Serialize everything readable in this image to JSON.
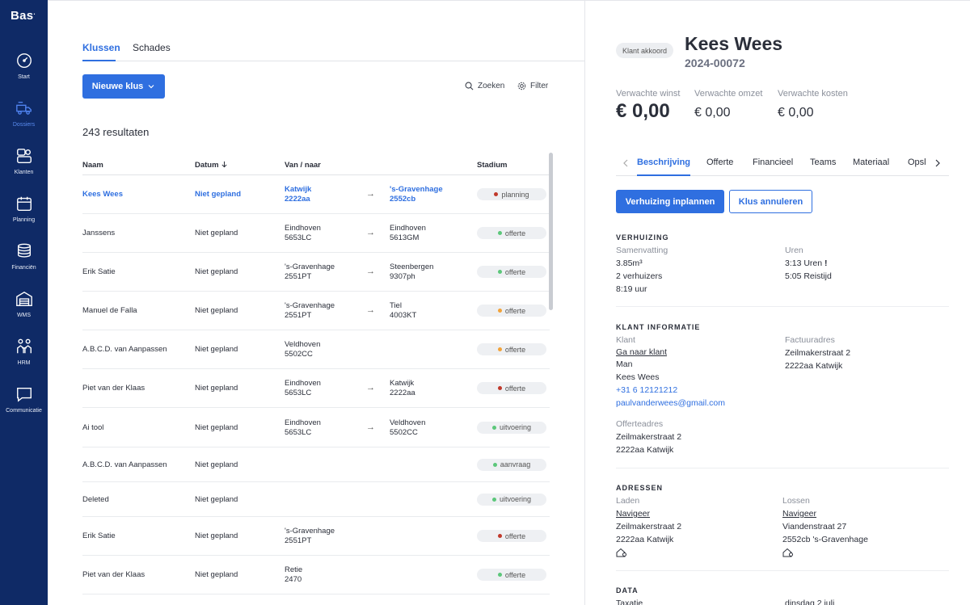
{
  "app": {
    "logo": "Bas",
    "logo_dot": "."
  },
  "sidebar": {
    "items": [
      {
        "label": "Start",
        "icon": "dashboard-icon"
      },
      {
        "label": "Dossiers",
        "icon": "truck-icon",
        "active": true
      },
      {
        "label": "Klanten",
        "icon": "users-icon"
      },
      {
        "label": "Planning",
        "icon": "calendar-icon"
      },
      {
        "label": "Financiën",
        "icon": "coins-icon"
      },
      {
        "label": "WMS",
        "icon": "warehouse-icon"
      },
      {
        "label": "HRM",
        "icon": "people-icon"
      },
      {
        "label": "Communicatie",
        "icon": "chat-icon"
      }
    ]
  },
  "list": {
    "tabs": [
      "Klussen",
      "Schades"
    ],
    "new_button": "Nieuwe klus",
    "search_label": "Zoeken",
    "filter_label": "Filter",
    "results": "243 resultaten",
    "columns": {
      "name": "Naam",
      "date": "Datum",
      "route": "Van / naar",
      "stage": "Stadium"
    },
    "rows": [
      {
        "name": "Kees Wees",
        "date": "Niet gepland",
        "from1": "Katwijk",
        "from2": "2222aa",
        "to1": "'s-Gravenhage",
        "to2": "2552cb",
        "stage": "planning",
        "color": "#c0392b",
        "highlight": true
      },
      {
        "name": "Janssens",
        "date": "Niet gepland",
        "from1": "Eindhoven",
        "from2": "5653LC",
        "to1": "Eindhoven",
        "to2": "5613GM",
        "stage": "offerte",
        "color": "#5cc77a"
      },
      {
        "name": "Erik Satie",
        "date": "Niet gepland",
        "from1": "'s-Gravenhage",
        "from2": "2551PT",
        "to1": "Steenbergen",
        "to2": "9307ph",
        "stage": "offerte",
        "color": "#5cc77a"
      },
      {
        "name": "Manuel de Falla",
        "date": "Niet gepland",
        "from1": "'s-Gravenhage",
        "from2": "2551PT",
        "to1": "Tiel",
        "to2": "4003KT",
        "stage": "offerte",
        "color": "#f2a33a"
      },
      {
        "name": "A.B.C.D. van Aanpassen",
        "date": "Niet gepland",
        "from1": "Veldhoven",
        "from2": "5502CC",
        "to1": "",
        "to2": "",
        "stage": "offerte",
        "color": "#f2a33a"
      },
      {
        "name": "Piet van der Klaas",
        "date": "Niet gepland",
        "from1": "Eindhoven",
        "from2": "5653LC",
        "to1": "Katwijk",
        "to2": "2222aa",
        "stage": "offerte",
        "color": "#c0392b"
      },
      {
        "name": "Ai tool",
        "date": "Niet gepland",
        "from1": "Eindhoven",
        "from2": "5653LC",
        "to1": "Veldhoven",
        "to2": "5502CC",
        "stage": "uitvoering",
        "color": "#5cc77a"
      },
      {
        "name": "A.B.C.D. van Aanpassen",
        "date": "Niet gepland",
        "from1": "",
        "from2": "",
        "to1": "",
        "to2": "",
        "stage": "aanvraag",
        "color": "#5cc77a"
      },
      {
        "name": "Deleted",
        "date": "Niet gepland",
        "from1": "",
        "from2": "",
        "to1": "",
        "to2": "",
        "stage": "uitvoering",
        "color": "#5cc77a"
      },
      {
        "name": "Erik Satie",
        "date": "Niet gepland",
        "from1": "'s-Gravenhage",
        "from2": "2551PT",
        "to1": "",
        "to2": "",
        "stage": "offerte",
        "color": "#c0392b"
      },
      {
        "name": "Piet van der Klaas",
        "date": "Niet gepland",
        "from1": "Retie",
        "from2": "2470",
        "to1": "",
        "to2": "",
        "stage": "offerte",
        "color": "#5cc77a"
      }
    ]
  },
  "detail": {
    "status": "Klant akkoord",
    "title": "Kees Wees",
    "number": "2024-00072",
    "metrics": [
      {
        "label": "Verwachte winst",
        "value": "€ 0,00"
      },
      {
        "label": "Verwachte omzet",
        "value": "€ 0,00"
      },
      {
        "label": "Verwachte kosten",
        "value": "€ 0,00"
      }
    ],
    "tabs": [
      "Beschrijving",
      "Offerte",
      "Financieel",
      "Teams",
      "Materiaal",
      "Opsl"
    ],
    "primary_button": "Verhuizing inplannen",
    "secondary_button": "Klus annuleren",
    "verhuizing": {
      "heading": "VERHUIZING",
      "summary_label": "Samenvatting",
      "summary": [
        "3.85m³",
        "2 verhuizers",
        "8:19 uur"
      ],
      "hours_label": "Uren",
      "hours": [
        "3:13 Uren",
        "5:05 Reistijd"
      ],
      "warning": "!"
    },
    "klant": {
      "heading": "KLANT INFORMATIE",
      "client_label": "Klant",
      "client_link": "Ga naar klant",
      "gender": "Man",
      "name": "Kees Wees",
      "phone": "+31 6 12121212",
      "email": "paulvanderwees@gmail.com",
      "invoice_label": "Factuuradres",
      "invoice": [
        "Zeilmakerstraat 2",
        "2222aa Katwijk"
      ],
      "quote_label": "Offerteadres",
      "quote": [
        "Zeilmakerstraat 2",
        "2222aa Katwijk"
      ]
    },
    "adressen": {
      "heading": "ADRESSEN",
      "load_label": "Laden",
      "unload_label": "Lossen",
      "navigate": "Navigeer",
      "load": [
        "Zeilmakerstraat 2",
        "2222aa Katwijk"
      ],
      "unload": [
        "Viandenstraat 27",
        "2552cb 's-Gravenhage"
      ]
    },
    "data": {
      "heading": "DATA",
      "row_label": "Taxatie",
      "row_value": "dinsdag 2 juli"
    }
  }
}
